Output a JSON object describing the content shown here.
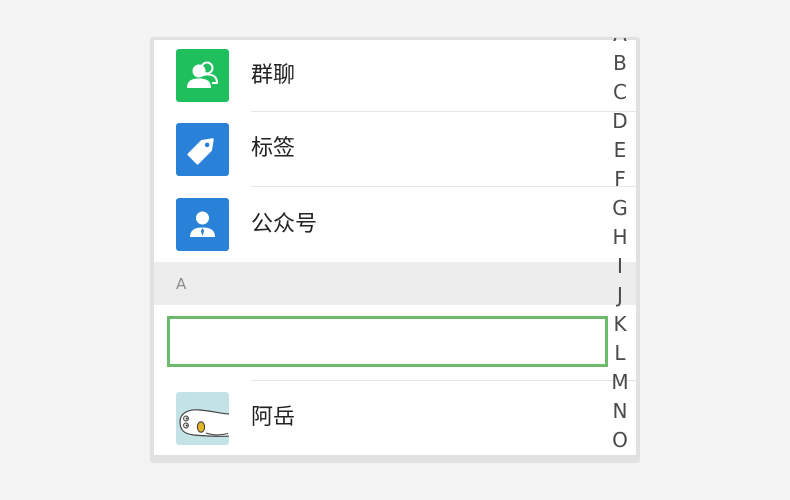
{
  "contacts_screen": {
    "menu_entries": [
      {
        "label": "群聊",
        "icon": "group-chat-icon",
        "icon_color": "#1fbf5e"
      },
      {
        "label": "标签",
        "icon": "tag-icon",
        "icon_color": "#2a82d8"
      },
      {
        "label": "公众号",
        "icon": "official-account-icon",
        "icon_color": "#2a82d8"
      }
    ],
    "section_header": "A",
    "contacts": [
      {
        "highlighted": true
      },
      {
        "name": "阿岳",
        "avatar": "cartoon-duck-avatar"
      }
    ]
  },
  "index_bar": {
    "letters": [
      "A",
      "B",
      "C",
      "D",
      "E",
      "F",
      "G",
      "H",
      "I",
      "J",
      "K",
      "L",
      "M",
      "N",
      "O"
    ]
  },
  "colors": {
    "highlight_border": "#6cbb6c",
    "section_background": "#ededed",
    "divider": "#e6e6e6",
    "avatar_background": "#c4e3e6"
  }
}
